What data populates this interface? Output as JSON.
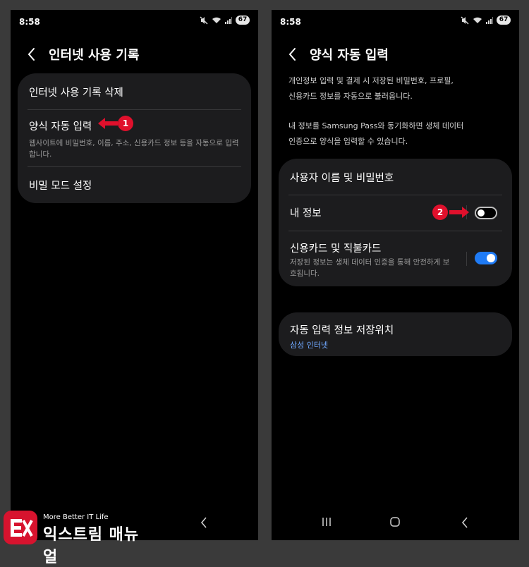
{
  "left": {
    "status": {
      "time": "8:58",
      "battery": "67"
    },
    "title": "인터넷 사용 기록",
    "items": [
      {
        "title": "인터넷 사용 기록 삭제"
      },
      {
        "title": "양식 자동 입력",
        "subtitle": "웹사이트에 비밀번호, 이름, 주소, 신용카드 정보 등을 자동으로 입력합니다."
      },
      {
        "title": "비밀 모드 설정"
      }
    ],
    "callout": "1"
  },
  "right": {
    "status": {
      "time": "8:58",
      "battery": "67"
    },
    "title": "양식 자동 입력",
    "description": [
      "개인정보 입력 및 결제 시 저장된 비밀번호, 프로필,",
      "신용카드 정보를 자동으로 불러옵니다.",
      "내 정보를 Samsung Pass와 동기화하면 생체 데이터",
      "인증으로 양식을 입력할 수 있습니다."
    ],
    "settings": [
      {
        "title": "사용자 이름 및 비밀번호"
      },
      {
        "title": "내 정보",
        "toggle": "off"
      },
      {
        "title": "신용카드 및 직불카드",
        "subtitle": "저장된 정보는 생체 데이터 인증을 통해 안전하게 보호됩니다.",
        "toggle": "on"
      }
    ],
    "storage": {
      "title": "자동 입력 정보 저장위치",
      "value": "삼성 인터넷"
    },
    "callout": "2"
  },
  "logo": {
    "tagline": "More Better IT Life",
    "name": "익스트림 매뉴얼"
  },
  "colors": {
    "accent_blue": "#1f7bf5",
    "callout_red": "#e0102c",
    "card": "#1c1c1e",
    "link_blue": "#6fa8ff"
  }
}
